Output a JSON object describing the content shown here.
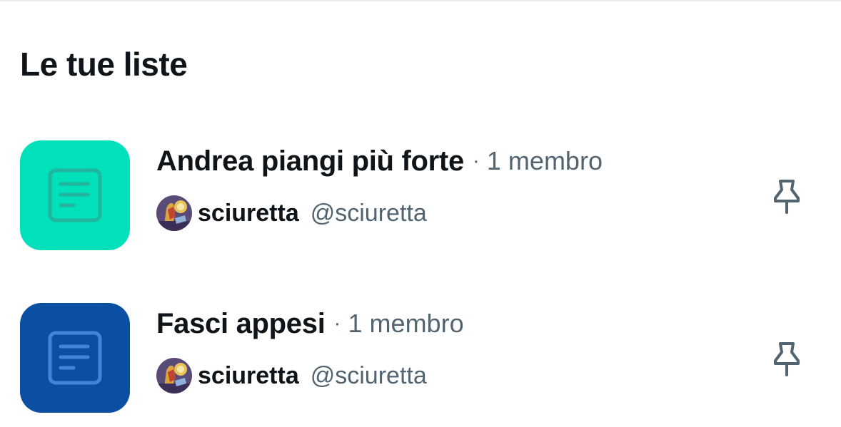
{
  "section": {
    "title": "Le tue liste"
  },
  "lists": [
    {
      "name": "Andrea piangi più forte",
      "separator": "·",
      "member_count": "1 membro",
      "owner_name": "sciuretta",
      "owner_handle": "@sciuretta",
      "cover_color": "#00e0bb",
      "cover_icon_color": "#22b59d",
      "icon": "list-icon",
      "pin_icon": "pin-icon"
    },
    {
      "name": "Fasci appesi",
      "separator": "·",
      "member_count": "1 membro",
      "owner_name": "sciuretta",
      "owner_handle": "@sciuretta",
      "cover_color": "#0b4fa3",
      "cover_icon_color": "#3f86d6",
      "icon": "list-icon",
      "pin_icon": "pin-icon"
    }
  ],
  "colors": {
    "primary_text": "#0f1419",
    "secondary_text": "#536471",
    "divider": "#e7e9ea"
  }
}
